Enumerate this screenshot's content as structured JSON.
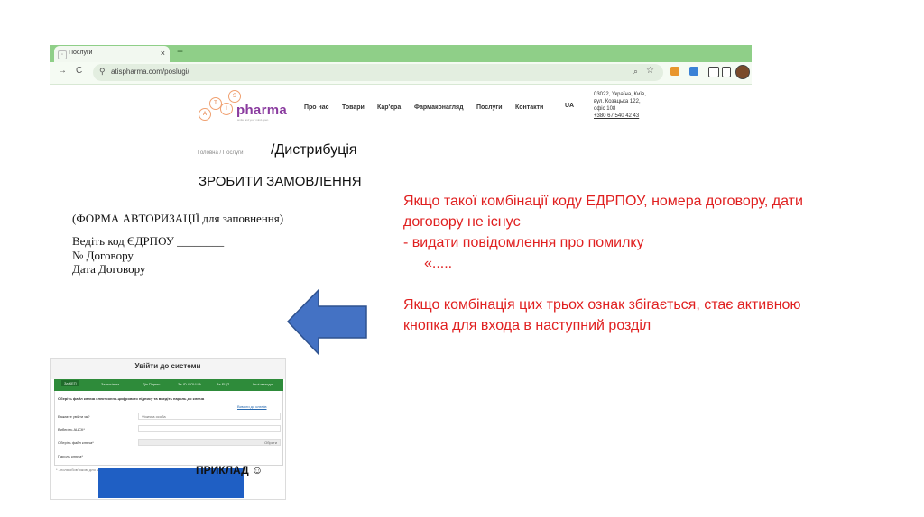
{
  "browser": {
    "tab_title": "Послуги",
    "tab_close": "×",
    "new_tab": "+",
    "url": "atispharma.com/poslugi/",
    "back": "→",
    "reload": "C"
  },
  "site": {
    "logo_letters": [
      "S",
      "I",
      "T",
      "A"
    ],
    "logo_word": "pharma",
    "logo_tagline": "smile and your mind open",
    "menu": [
      "Про нас",
      "Товари",
      "Кар'єра",
      "Фармаконагляд",
      "Послуги",
      "Контакти",
      "UA"
    ],
    "contacts": {
      "line1": "03022, Україна, Київ,",
      "line2": "вул. Козацька 122,",
      "line3": "офіс 108",
      "phone": "+380 67 540 42 43"
    },
    "breadcrumb": "Головна  /  Послуги"
  },
  "slide": {
    "page_title": "/Дистрибуція",
    "order_title": "ЗРОБИТИ ЗАМОВЛЕННЯ",
    "form_caption": "(ФОРМА АВТОРИЗАЦІЇ  для заповнення)",
    "form_line1": "Ведіть код ЄДРПОУ ________",
    "form_line2": "№ Договору",
    "form_line3": "Дата Договору",
    "note_line1": "Якщо такої комбінації коду ЕДРПОУ, номера договору, дати",
    "note_line2": "договору не існує",
    "note_line3": "-    видати повідомлення про помилку",
    "note_line4": "«.....",
    "note_line5": "Якщо комбінація цих трьох ознак збігається, стає активною",
    "note_line6": "кнопка для входа в наступний розділ",
    "example_label": "ПРИКЛАД ☺"
  },
  "login": {
    "title": "Увійти до системи",
    "tabs": [
      "За КЕП",
      "За логіном",
      "Дія.Підпис",
      "За ID.GOV.UA",
      "За ЕЦП",
      "Інші методи"
    ],
    "instruction": "Оберіть файл ключа електронно-цифрового підпису та введіть пароль до ключа",
    "link": "Вимоги до ключів",
    "row1_label": "Бажаєте увійти як?",
    "row1_value": "Фізична особа",
    "row2_label": "Виберіть АЦСК*",
    "row3_label": "Оберіть файл ключа*",
    "row3_value": "Обрати",
    "row4_label": "Пароль ключа*",
    "footnote": "* - поля обов'язкові для заповнення"
  },
  "colors": {
    "accent_red": "#e02020",
    "arrow_blue": "#4472c4",
    "browser_green": "#8fcf88",
    "login_green": "#2e8b3a",
    "blue_rect": "#1f5fc4"
  }
}
